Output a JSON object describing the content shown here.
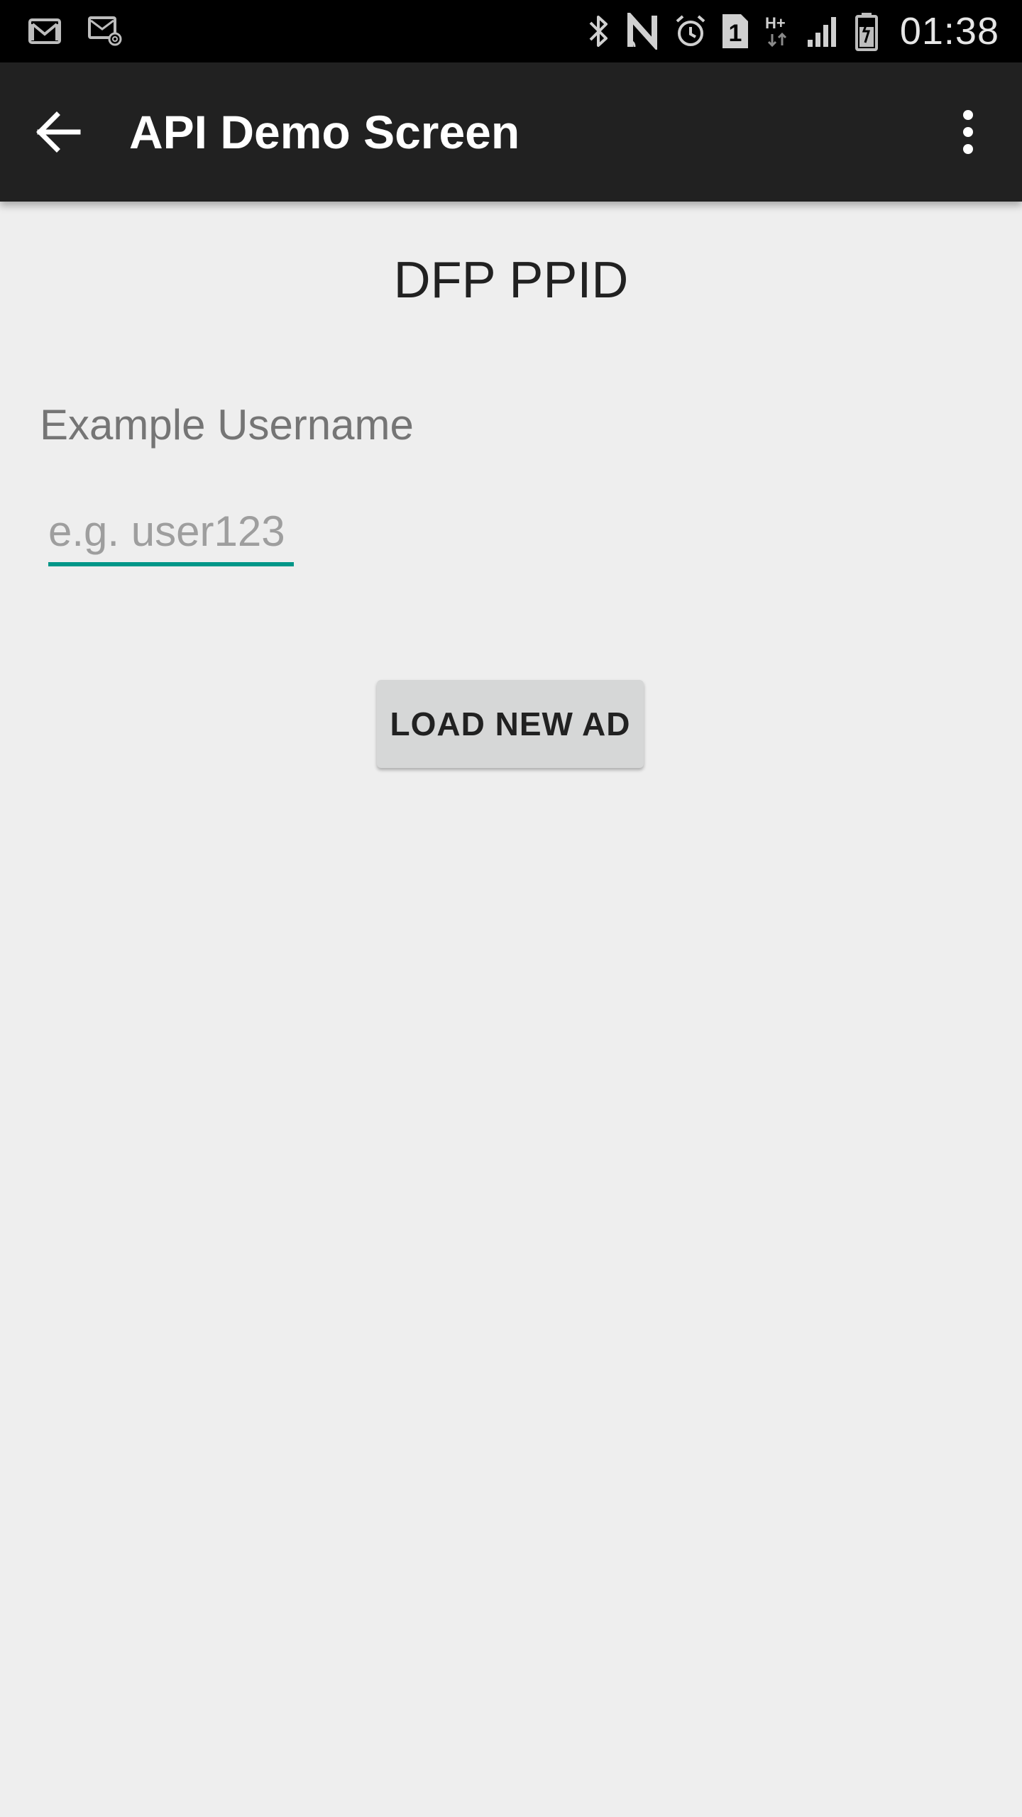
{
  "status_bar": {
    "time": "01:38",
    "hplus_label": "H+",
    "sim_label": "1",
    "icons": {
      "left": [
        "gmail-icon",
        "email-notification-icon"
      ],
      "right": [
        "bluetooth-icon",
        "nfc-icon",
        "alarm-icon",
        "sim-1-icon",
        "hplus-data-icon",
        "signal-icon",
        "battery-icon"
      ]
    }
  },
  "app_bar": {
    "title": "API Demo Screen",
    "back_icon": "back-arrow-icon",
    "menu_icon": "overflow-menu-icon"
  },
  "content": {
    "heading": "DFP PPID",
    "username_label": "Example Username",
    "username_placeholder": "e.g. user123",
    "username_value": "",
    "load_button_label": "LOAD NEW AD"
  },
  "colors": {
    "status_bar_bg": "#000000",
    "app_bar_bg": "#212121",
    "background": "#eeeeee",
    "accent": "#009688",
    "button_bg": "#d6d7d7"
  }
}
